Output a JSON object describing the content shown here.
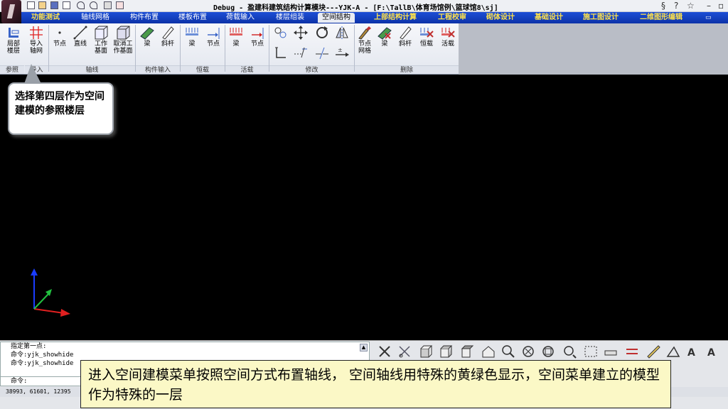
{
  "title_bar": {
    "title": "Debug - 盈建科建筑结构计算模块---YJK-A - [F:\\TallB\\体育场馆例\\篮球馆8\\sj]"
  },
  "menu_tabs": [
    {
      "label": "功能测试",
      "active": false,
      "yellow": true
    },
    {
      "label": "轴线网格",
      "active": false,
      "yellow": false
    },
    {
      "label": "构件布置",
      "active": false,
      "yellow": false
    },
    {
      "label": "楼板布置",
      "active": false,
      "yellow": false
    },
    {
      "label": "荷载输入",
      "active": false,
      "yellow": false
    },
    {
      "label": "楼层组装",
      "active": false,
      "yellow": false
    },
    {
      "label": "空间结构",
      "active": true,
      "yellow": false
    },
    {
      "label": "上部结构计算",
      "active": false,
      "yellow": true
    },
    {
      "label": "工程校审",
      "active": false,
      "yellow": true
    },
    {
      "label": "砌体设计",
      "active": false,
      "yellow": true
    },
    {
      "label": "基础设计",
      "active": false,
      "yellow": true
    },
    {
      "label": "施工图设计",
      "active": false,
      "yellow": true
    },
    {
      "label": "二维图形编辑",
      "active": false,
      "yellow": true
    }
  ],
  "ribbon": {
    "groups": [
      {
        "label": "参照",
        "tools": [
          {
            "label": "局部\n楼层",
            "icon": "floor-layer-icon"
          }
        ]
      },
      {
        "label": "导入",
        "tools": [
          {
            "label": "导入\n轴网",
            "icon": "import-grid-icon"
          }
        ]
      },
      {
        "label": "轴线",
        "tools": [
          {
            "label": "节点",
            "icon": "node-icon"
          },
          {
            "label": "直线",
            "icon": "line-icon"
          },
          {
            "label": "工作\n基面",
            "icon": "work-plane-icon"
          },
          {
            "label": "取消工\n作基面",
            "icon": "cancel-work-plane-icon"
          }
        ]
      },
      {
        "label": "构件输入",
        "tools": [
          {
            "label": "梁",
            "icon": "beam-icon"
          },
          {
            "label": "斜杆",
            "icon": "brace-icon"
          }
        ]
      },
      {
        "label": "恒载",
        "tools": [
          {
            "label": "梁",
            "icon": "dead-load-beam-icon"
          },
          {
            "label": "节点",
            "icon": "dead-load-node-icon"
          }
        ]
      },
      {
        "label": "活载",
        "tools": [
          {
            "label": "梁",
            "icon": "live-load-beam-icon"
          },
          {
            "label": "节点",
            "icon": "live-load-node-icon"
          }
        ]
      },
      {
        "label": "修改",
        "tools": [
          {
            "label": "",
            "icon": "copy-icon"
          },
          {
            "label": "",
            "icon": "move-icon"
          },
          {
            "label": "",
            "icon": "rotate-icon"
          },
          {
            "label": "",
            "icon": "mirror-icon"
          }
        ]
      },
      {
        "label": "删除",
        "tools": [
          {
            "label": "节点\n网格",
            "icon": "delete-node-grid-icon"
          },
          {
            "label": "梁",
            "icon": "delete-beam-icon"
          },
          {
            "label": "斜杆",
            "icon": "delete-brace-icon"
          },
          {
            "label": "恒载",
            "icon": "delete-dead-load-icon"
          },
          {
            "label": "活载",
            "icon": "delete-live-load-icon"
          }
        ]
      }
    ]
  },
  "tooltip": {
    "text": "选择第四层作为空间建模的参照楼层"
  },
  "command": {
    "log": [
      "指定第一点:",
      "命令:yjk_showhide",
      "命令:yjk_showhide"
    ],
    "prompt": "命令:"
  },
  "status_bar": {
    "coords": "38993, 61601, 12395"
  },
  "caption": {
    "text": "进入空间建模菜单按照空间方式布置轴线， 空间轴线用特殊的黄绿色显示，空间菜单建立的模型作为特殊的一层"
  },
  "colors": {
    "menu_bar": "#0c32a8",
    "axis_x": "#e02020",
    "axis_y": "#1a3cff",
    "axis_z": "#22c040",
    "caption_bg": "#fbf8c6"
  }
}
